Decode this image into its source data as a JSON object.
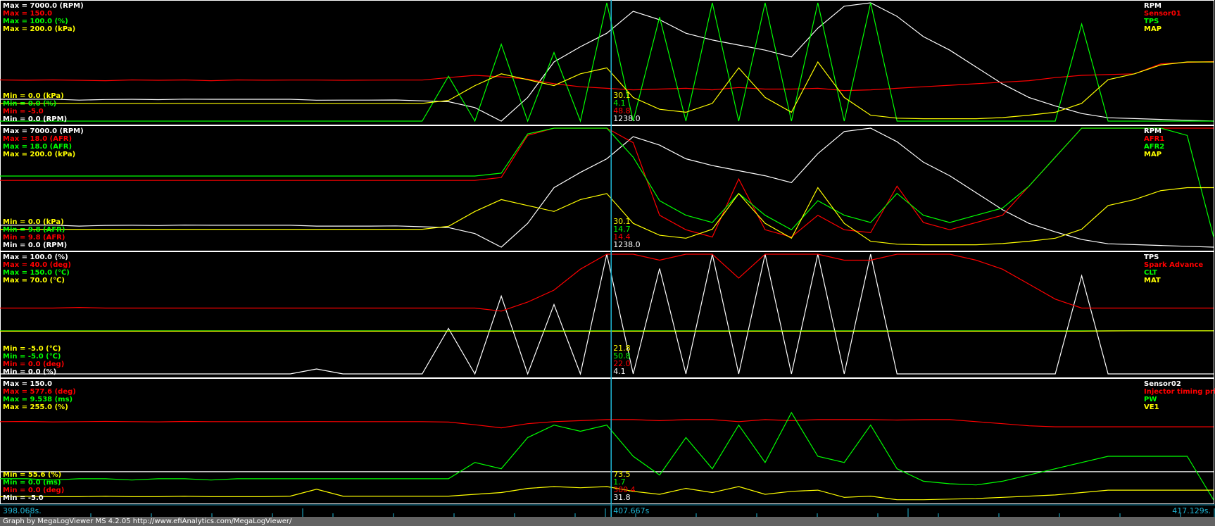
{
  "footer": "Graph by MegaLogViewer MS 4.2.05 http://www.efiAnalytics.com/MegaLogViewer/",
  "colors": {
    "white": "#ffffff",
    "red": "#ff0000",
    "green": "#00ff00",
    "yellow": "#ffff00",
    "cursor": "#1fb7d6",
    "grid": "#1a8fb0",
    "bg": "#000000"
  },
  "timeline": {
    "start": "398.068s.",
    "cursor": "407.667s",
    "end": "417.129s."
  },
  "chart_data": [
    {
      "type": "line",
      "x_range": [
        398.068,
        417.129
      ],
      "cursor_x": 407.667,
      "cursor_values": [
        "30.1",
        "4.1",
        "48.8",
        "1238.0"
      ],
      "series": [
        {
          "name": "RPM",
          "color": "white",
          "max_label": "Max = 7000.0 (RPM)",
          "min_label": "Min = 0.0 (RPM)",
          "range": [
            0,
            7000
          ],
          "values": [
            1290,
            1290,
            1300,
            1240,
            1280,
            1290,
            1270,
            1300,
            1290,
            1290,
            1290,
            1290,
            1238,
            1240,
            1240,
            1250,
            1200,
            1150,
            800,
            0,
            1400,
            3500,
            4400,
            5200,
            6500,
            6000,
            5200,
            4800,
            4500,
            4200,
            3800,
            5500,
            6800,
            7000,
            6200,
            5000,
            4200,
            3200,
            2200,
            1400,
            900,
            450,
            200,
            150,
            100,
            50,
            0
          ]
        },
        {
          "name": "Sensor01",
          "color": "red",
          "max_label": "Max = 150.0",
          "min_label": "Min = -5.0",
          "range": [
            -5,
            150
          ],
          "values": [
            49,
            48.5,
            49,
            48.5,
            48,
            49,
            48.5,
            49,
            48,
            49,
            48.6,
            48.8,
            48.8,
            48.5,
            48.7,
            48.8,
            48.8,
            52,
            55,
            53,
            50,
            44,
            40,
            38,
            36,
            37,
            38,
            36,
            39,
            37,
            37,
            38,
            35,
            36,
            38,
            40,
            42,
            44,
            46,
            48,
            52,
            55,
            56,
            57,
            70,
            72,
            73
          ]
        },
        {
          "name": "TPS",
          "color": "green",
          "max_label": "Max = 100.0 (%)",
          "min_label": "Min = 0.0 (%)",
          "range": [
            0,
            100
          ],
          "values": [
            0,
            0,
            0,
            0,
            0,
            0,
            0,
            0,
            0,
            0,
            0,
            0,
            0,
            0,
            0,
            0,
            0,
            38,
            0,
            65,
            0,
            58,
            0,
            100,
            0,
            88,
            0,
            100,
            0,
            100,
            0,
            100,
            0,
            100,
            0,
            0,
            0,
            0,
            0,
            0,
            0,
            82,
            0,
            0,
            0,
            0,
            0
          ]
        },
        {
          "name": "MAP",
          "color": "yellow",
          "max_label": "Max = 200.0 (kPa)",
          "min_label": "Min = 0.0 (kPa)",
          "range": [
            0,
            200
          ],
          "values": [
            30,
            30,
            30,
            30,
            30,
            30,
            30,
            30,
            30,
            30,
            30,
            30,
            30.1,
            30,
            30,
            30,
            30,
            35,
            60,
            80,
            70,
            60,
            80,
            90,
            40,
            20,
            15,
            30,
            90,
            40,
            15,
            100,
            40,
            10,
            5,
            4,
            4,
            4,
            6,
            10,
            15,
            30,
            70,
            80,
            95,
            100,
            100
          ]
        }
      ]
    },
    {
      "type": "line",
      "x_range": [
        398.068,
        417.129
      ],
      "cursor_x": 407.667,
      "cursor_values": [
        "30.1",
        "14.7",
        "14.4",
        "1238.0"
      ],
      "series": [
        {
          "name": "RPM",
          "color": "white",
          "max_label": "Max = 7000.0 (RPM)",
          "min_label": "Min = 0.0 (RPM)",
          "range": [
            0,
            7000
          ],
          "values": [
            1290,
            1290,
            1300,
            1240,
            1280,
            1290,
            1270,
            1300,
            1290,
            1290,
            1290,
            1290,
            1238,
            1240,
            1240,
            1250,
            1200,
            1150,
            800,
            0,
            1400,
            3500,
            4400,
            5200,
            6500,
            6000,
            5200,
            4800,
            4500,
            4200,
            3800,
            5500,
            6800,
            7000,
            6200,
            5000,
            4200,
            3200,
            2200,
            1400,
            900,
            450,
            200,
            150,
            100,
            50,
            0
          ]
        },
        {
          "name": "AFR1",
          "color": "red",
          "max_label": "Max = 18.0 (AFR)",
          "min_label": "Min = 9.8 (AFR)",
          "range": [
            9.8,
            18
          ],
          "values": [
            14.4,
            14.4,
            14.4,
            14.4,
            14.4,
            14.4,
            14.4,
            14.4,
            14.4,
            14.4,
            14.4,
            14.4,
            14.4,
            14.4,
            14.4,
            14.4,
            14.4,
            14.4,
            14.4,
            14.6,
            17.5,
            18,
            18,
            18,
            17,
            12,
            11,
            10.5,
            14.5,
            11,
            10.5,
            12,
            11,
            10.8,
            14,
            11.5,
            11,
            11.5,
            12,
            14,
            16,
            18,
            18,
            18,
            18,
            18,
            18
          ]
        },
        {
          "name": "AFR2",
          "color": "green",
          "max_label": "Max = 18.0 (AFR)",
          "min_label": "Min = 9.8 (AFR)",
          "range": [
            9.8,
            18
          ],
          "values": [
            14.7,
            14.7,
            14.7,
            14.7,
            14.7,
            14.7,
            14.7,
            14.7,
            14.7,
            14.7,
            14.7,
            14.7,
            14.7,
            14.7,
            14.7,
            14.7,
            14.7,
            14.7,
            14.7,
            14.9,
            17.6,
            18,
            18,
            18,
            16,
            13,
            12,
            11.5,
            13.5,
            12,
            11,
            13,
            12,
            11.5,
            13.5,
            12,
            11.5,
            12,
            12.5,
            14,
            16,
            18,
            18,
            18,
            18,
            17.5,
            10.5
          ]
        },
        {
          "name": "MAP",
          "color": "yellow",
          "max_label": "Max = 200.0 (kPa)",
          "min_label": "Min = 0.0 (kPa)",
          "range": [
            0,
            200
          ],
          "values": [
            30,
            30,
            30,
            30,
            30,
            30,
            30,
            30,
            30,
            30,
            30,
            30,
            30.1,
            30,
            30,
            30,
            30,
            35,
            60,
            80,
            70,
            60,
            80,
            90,
            40,
            20,
            15,
            30,
            90,
            40,
            15,
            100,
            40,
            10,
            5,
            4,
            4,
            4,
            6,
            10,
            15,
            30,
            70,
            80,
            95,
            100,
            100
          ]
        }
      ]
    },
    {
      "type": "line",
      "x_range": [
        398.068,
        417.129
      ],
      "cursor_x": 407.667,
      "cursor_values": [
        "21.8",
        "50.8",
        "22.0",
        "4.1"
      ],
      "series": [
        {
          "name": "TPS",
          "color": "white",
          "max_label": "Max = 100.0 (%)",
          "min_label": "Min = 0.0 (%)",
          "range": [
            0,
            100
          ],
          "values": [
            0,
            0,
            0,
            0,
            0,
            0,
            0,
            0,
            0,
            0,
            0,
            0,
            4.1,
            0,
            0,
            0,
            0,
            38,
            0,
            65,
            0,
            58,
            0,
            100,
            0,
            88,
            0,
            100,
            0,
            100,
            0,
            100,
            0,
            100,
            0,
            0,
            0,
            0,
            0,
            0,
            0,
            82,
            0,
            0,
            0,
            0,
            0
          ]
        },
        {
          "name": "Spark Advance",
          "color": "red",
          "max_label": "Max = 40.0 (deg)",
          "min_label": "Min = 0.0 (deg)",
          "range": [
            0,
            40
          ],
          "values": [
            22,
            22,
            22,
            22.2,
            22,
            22,
            22,
            22,
            22,
            22,
            22,
            22,
            22,
            22,
            22,
            22,
            22,
            22,
            22,
            21,
            24,
            28,
            35,
            40,
            40,
            38,
            40,
            40,
            32,
            40,
            40,
            40,
            38,
            38,
            40,
            40,
            40,
            38,
            35,
            30,
            25,
            22,
            22,
            22,
            22,
            22,
            22
          ]
        },
        {
          "name": "CLT",
          "color": "green",
          "max_label": "Max = 150.0 (℃)",
          "min_label": "Min = -5.0 (℃)",
          "range": [
            -5,
            150
          ],
          "values": [
            50.8,
            50.8,
            50.8,
            50.8,
            50.8,
            50.8,
            50.8,
            50.8,
            50.8,
            50.8,
            50.8,
            50.8,
            50.8,
            50.8,
            50.8,
            50.8,
            50.8,
            50.8,
            50.8,
            50.8,
            50.8,
            50.8,
            50.8,
            50.8,
            50.8,
            50.8,
            50.8,
            50.8,
            50.8,
            50.8,
            50.8,
            50.8,
            50.8,
            50.8,
            50.8,
            50.8,
            50.8,
            50.8,
            50.8,
            50.8,
            50.8,
            50.8,
            50.8,
            50.8,
            50.8,
            50.8,
            50.8
          ]
        },
        {
          "name": "MAT",
          "color": "yellow",
          "max_label": "Max = 70.0 (℃)",
          "min_label": "Min = -5.0 (℃)",
          "range": [
            -5,
            70
          ],
          "values": [
            21.8,
            21.8,
            21.8,
            21.8,
            21.8,
            21.8,
            21.8,
            21.8,
            21.8,
            21.8,
            21.8,
            21.8,
            21.8,
            21.8,
            21.8,
            21.8,
            21.8,
            21.8,
            21.8,
            21.8,
            21.8,
            21.8,
            21.8,
            21.8,
            21.8,
            21.8,
            21.8,
            21.8,
            21.8,
            21.8,
            21.8,
            21.8,
            21.8,
            21.8,
            21.8,
            21.8,
            21.8,
            21.8,
            21.8,
            21.8,
            21.8,
            21.8,
            21.9,
            22,
            22,
            22,
            22
          ]
        }
      ]
    },
    {
      "type": "line",
      "x_range": [
        398.068,
        417.129
      ],
      "cursor_x": 407.667,
      "cursor_values": [
        "73.5",
        "1.7",
        "380.4",
        "31.8"
      ],
      "series": [
        {
          "name": "Sensor02",
          "color": "white",
          "max_label": "Max = 150.0",
          "min_label": "Min = -5.0",
          "range": [
            -5,
            150
          ],
          "values": [
            31.8,
            31.8,
            31.8,
            31.8,
            31.8,
            31.8,
            31.8,
            31.8,
            31.8,
            31.8,
            31.8,
            31.8,
            31.8,
            31.8,
            31.8,
            31.8,
            31.8,
            31.8,
            31.8,
            31.8,
            31.8,
            31.8,
            31.8,
            31.8,
            31.8,
            31.8,
            31.8,
            31.8,
            31.8,
            31.8,
            31.8,
            31.8,
            31.8,
            31.8,
            31.8,
            31.8,
            31.8,
            31.8,
            31.8,
            31.8,
            31.8,
            31.8,
            31.8,
            31.8,
            31.8,
            31.8,
            31.8
          ]
        },
        {
          "name": "Injector timing pri",
          "color": "red",
          "max_label": "Max = 577.6 (deg)",
          "min_label": "Min = 0.0 (deg)",
          "range": [
            0,
            577.6
          ],
          "values": [
            380,
            381,
            379,
            380,
            381,
            380,
            379,
            381,
            380,
            380,
            380,
            380,
            380.4,
            380,
            380,
            380,
            380,
            378,
            365,
            350,
            370,
            380,
            385,
            390,
            390,
            385,
            390,
            390,
            380,
            390,
            385,
            390,
            390,
            390,
            388,
            390,
            390,
            380,
            370,
            360,
            355,
            355,
            355,
            355,
            355,
            355,
            355
          ]
        },
        {
          "name": "PW",
          "color": "green",
          "max_label": "Max = 9.538 (ms)",
          "min_label": "Min = 0.0 (ms)",
          "range": [
            0,
            9.538
          ],
          "values": [
            1.7,
            1.7,
            1.6,
            1.7,
            1.7,
            1.6,
            1.7,
            1.7,
            1.6,
            1.7,
            1.7,
            1.7,
            1.7,
            1.7,
            1.7,
            1.7,
            1.7,
            1.7,
            3,
            2.5,
            5,
            6,
            5.5,
            6,
            3.5,
            2,
            5,
            2.5,
            6,
            3,
            7,
            3.5,
            3,
            6,
            2.5,
            1.5,
            1.3,
            1.2,
            1.5,
            2,
            2.5,
            3,
            3.5,
            3.5,
            3.5,
            3.5,
            0
          ]
        },
        {
          "name": "VE1",
          "color": "yellow",
          "max_label": "Max = 255.0 (%)",
          "min_label": "Min = 55.6 (%)",
          "range": [
            55.6,
            255
          ],
          "values": [
            61,
            62,
            61,
            61,
            62,
            61,
            61,
            62,
            61,
            61,
            61,
            62,
            73.5,
            62,
            62,
            62,
            62,
            62,
            65,
            68,
            75,
            78,
            76,
            78,
            70,
            65,
            75,
            68,
            78,
            65,
            70,
            72,
            60,
            62,
            56,
            56,
            57,
            58,
            60,
            62,
            64,
            68,
            72,
            72,
            72,
            72,
            72
          ]
        }
      ]
    }
  ]
}
